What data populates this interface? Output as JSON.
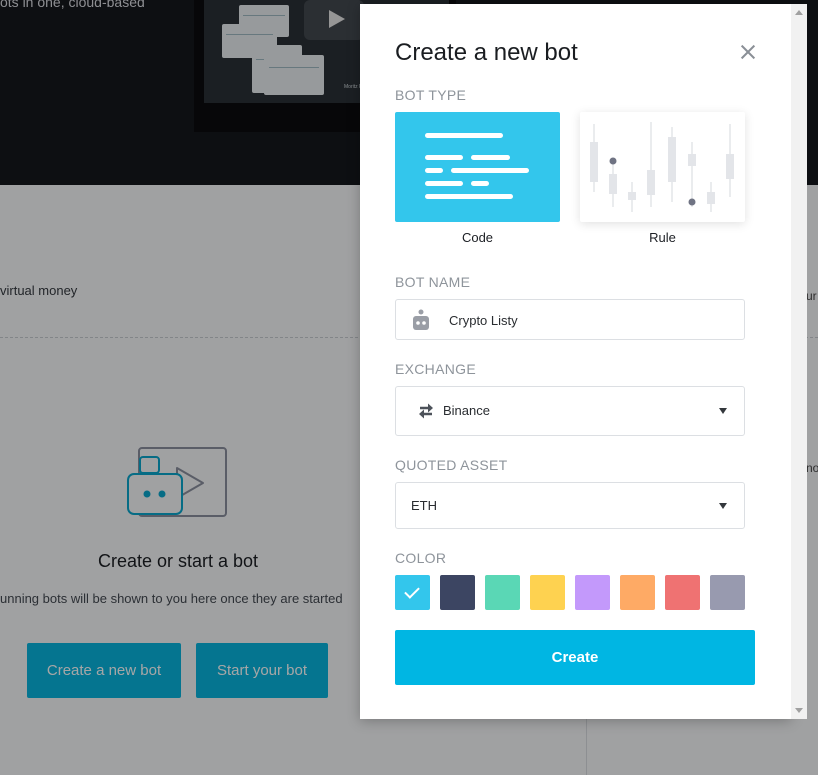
{
  "background": {
    "hero_text": "ots in one, cloud-based",
    "video_caption": "Moritz Pe...",
    "mid_text": "virtual money",
    "right_text_1": "ur",
    "right_text_2": "no",
    "empty_state": {
      "title": "Create or start a bot",
      "subtitle": "unning bots will be shown to you here once they are started",
      "create_button": "Create a new bot",
      "start_button": "Start your bot"
    }
  },
  "modal": {
    "title": "Create a new bot",
    "bot_type": {
      "label": "BOT TYPE",
      "options": [
        {
          "name": "Code",
          "selected": true,
          "color": "#33c6ec"
        },
        {
          "name": "Rule",
          "selected": false
        }
      ]
    },
    "bot_name": {
      "label": "BOT NAME",
      "value": "Crypto Listy",
      "icon": "robot-icon"
    },
    "exchange": {
      "label": "EXCHANGE",
      "value": "Binance",
      "icon": "swap-arrows-icon"
    },
    "quoted_asset": {
      "label": "QUOTED ASSET",
      "value": "ETH"
    },
    "color": {
      "label": "COLOR",
      "selected_index": 0,
      "swatches": [
        "#33c6ec",
        "#3c4562",
        "#5ad7b5",
        "#fed250",
        "#c399fb",
        "#feaa65",
        "#ef7272",
        "#989aaf"
      ]
    },
    "create_button": "Create"
  }
}
